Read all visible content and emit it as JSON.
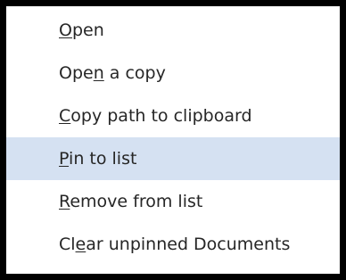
{
  "context_menu": {
    "highlight_color": "#d5e1f2",
    "items": [
      {
        "pre": "",
        "key": "O",
        "post": "pen",
        "highlighted": false
      },
      {
        "pre": "Ope",
        "key": "n",
        "post": " a copy",
        "highlighted": false
      },
      {
        "pre": "",
        "key": "C",
        "post": "opy path to clipboard",
        "highlighted": false
      },
      {
        "pre": "",
        "key": "P",
        "post": "in to list",
        "highlighted": true
      },
      {
        "pre": "",
        "key": "R",
        "post": "emove from list",
        "highlighted": false
      },
      {
        "pre": "Cl",
        "key": "e",
        "post": "ar unpinned Documents",
        "highlighted": false
      }
    ]
  }
}
